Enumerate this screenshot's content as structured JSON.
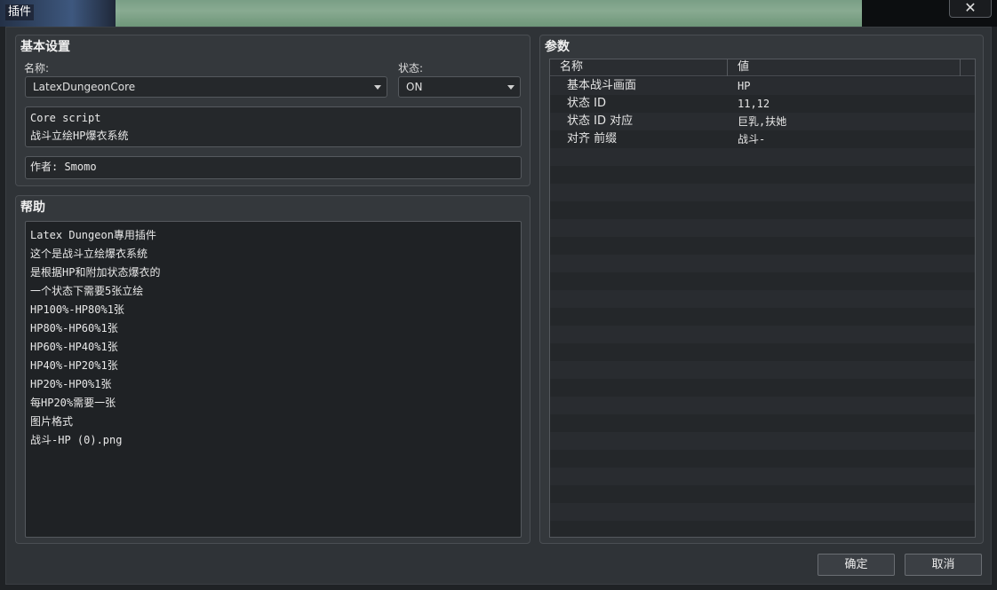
{
  "window": {
    "title": "插件",
    "close_icon": "close-icon"
  },
  "basic": {
    "title": "基本设置",
    "name_label": "名称:",
    "name_value": "LatexDungeonCore",
    "status_label": "状态:",
    "status_value": "ON",
    "description_lines": [
      "Core script",
      "战斗立绘HP爆衣系统"
    ],
    "author": "作者: Smomo"
  },
  "help": {
    "title": "帮助",
    "lines": [
      "Latex Dungeon專用插件",
      "这个是战斗立绘爆衣系统",
      "是根据HP和附加状态爆衣的",
      "一个状态下需要5张立绘",
      "HP100%-HP80%1张",
      "HP80%-HP60%1张",
      "HP60%-HP40%1张",
      "HP40%-HP20%1张",
      "HP20%-HP0%1张",
      "每HP20%需要一张",
      "图片格式",
      "战斗-HP (0).png"
    ]
  },
  "params": {
    "title": "参数",
    "col_name": "名称",
    "col_value": "値",
    "rows": [
      {
        "name": "基本战斗画面",
        "value": "HP"
      },
      {
        "name": "状态 ID",
        "value": "11,12"
      },
      {
        "name": "状态 ID 对应",
        "value": "巨乳,扶她"
      },
      {
        "name": "对齐 前缀",
        "value": "战斗-"
      }
    ]
  },
  "buttons": {
    "ok": "确定",
    "cancel": "取消"
  }
}
